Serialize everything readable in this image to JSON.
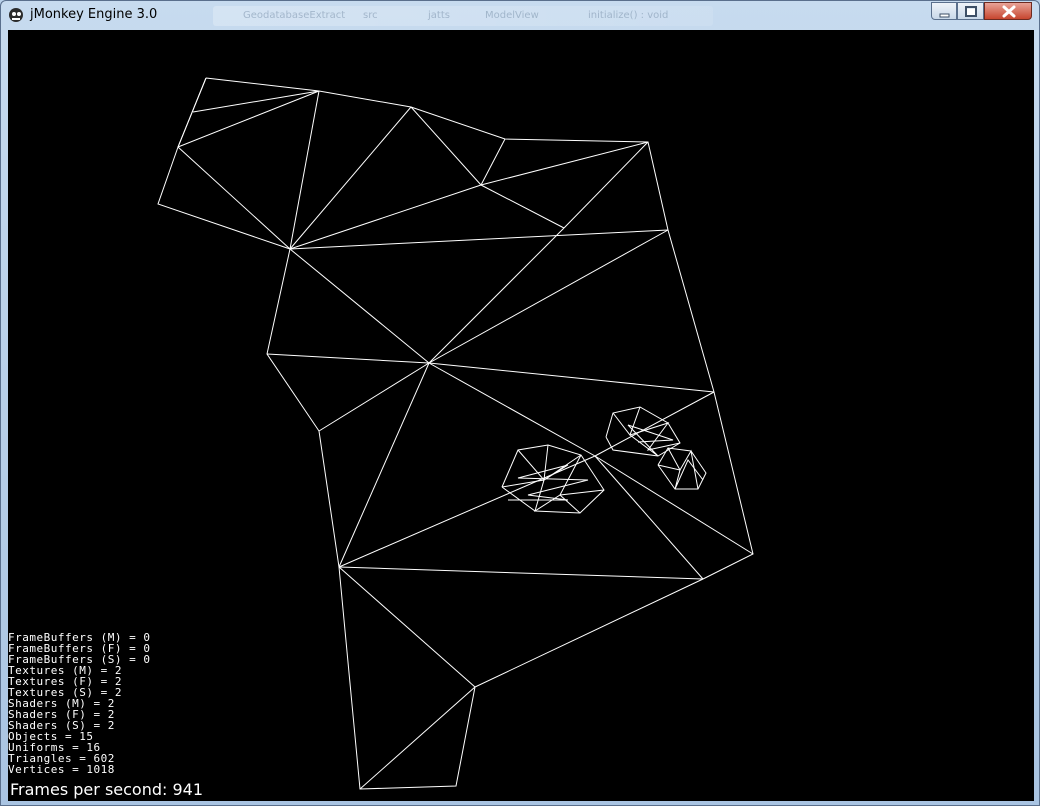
{
  "window": {
    "title": "jMonkey Engine 3.0",
    "taskbar_ghost": [
      "GeodatabaseExtract",
      "src",
      "jatts",
      "ModelView",
      "initialize() : void"
    ]
  },
  "controls": {
    "minimize_icon": "minimize-icon",
    "maximize_icon": "maximize-icon",
    "close_icon": "close-icon"
  },
  "scene": {
    "background": "#000000",
    "wire_color": "#ffffff"
  },
  "stats": [
    "FrameBuffers (M) = 0",
    "FrameBuffers (F) = 0",
    "FrameBuffers (S) = 0",
    "Textures (M) = 2",
    "Textures (F) = 2",
    "Textures (S) = 2",
    "Shaders (M) = 2",
    "Shaders (F) = 2",
    "Shaders (S) = 2",
    "Objects = 15",
    "Uniforms = 16",
    "Triangles = 602",
    "Vertices = 1018"
  ],
  "fps_text": "Frames per second: 941"
}
